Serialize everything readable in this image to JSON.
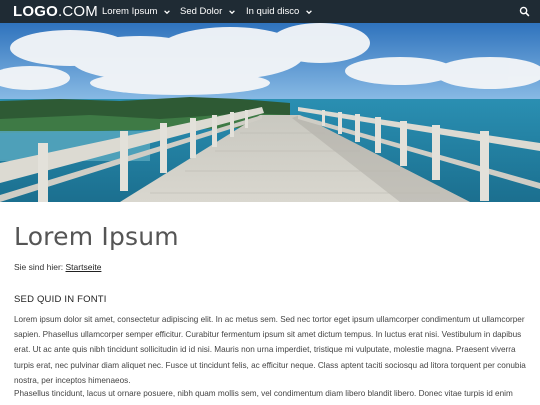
{
  "header": {
    "logo_bold": "LOGO",
    "logo_light": ".COM",
    "nav": [
      {
        "label": "Lorem Ipsum"
      },
      {
        "label": "Sed Dolor"
      },
      {
        "label": "In quid disco"
      }
    ]
  },
  "page": {
    "title": "Lorem Ipsum",
    "breadcrumb_prefix": "Sie sind hier:",
    "breadcrumb_link": "Startseite",
    "section_title": "SED QUID IN FONTI",
    "paragraph1": "Lorem ipsum dolor sit amet, consectetur adipiscing elit. In ac metus sem. Sed nec tortor eget ipsum ullamcorper condimentum ut ullamcorper sapien. Phasellus ullamcorper semper efficitur. Curabitur fermentum ipsum sit amet dictum tempus. In luctus erat nisi. Vestibulum in dapibus erat. Ut ac ante quis nibh tincidunt sollicitudin id id nisi. Mauris non urna imperdiet, tristique mi vulputate, molestie magna. Praesent viverra turpis erat, nec pulvinar diam aliquet nec. Fusce ut tincidunt felis, ac efficitur neque. Class aptent taciti sociosqu ad litora torquent per conubia nostra, per inceptos himenaeos.",
    "paragraph2": "Phasellus tincidunt, lacus ut ornare posuere, nibh quam mollis sem, vel condimentum diam libero blandit libero. Donec vitae turpis id enim"
  },
  "colors": {
    "topbar": "#1f2b34",
    "sky": "#3a7fc4",
    "sea": "#1f86a8"
  },
  "icons": {
    "search": "search-icon",
    "chevron": "chevron-down-icon"
  }
}
